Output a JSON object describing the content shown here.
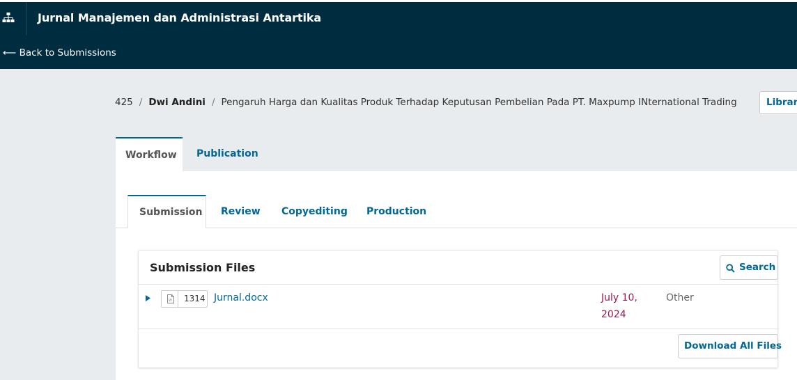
{
  "header": {
    "journal_title": "Jurnal Manajemen dan Administrasi Antartika",
    "back_link": "⟵ Back to Submissions",
    "site_icon": "sitemap-icon"
  },
  "breadcrumb": {
    "id": "425",
    "separator": "/",
    "author": "Dwi Andini",
    "title": "Pengaruh Harga dan Kualitas Produk Terhadap Keputusan Pembelian Pada PT. Maxpump INternational Trading",
    "library_button": "Library"
  },
  "main_tabs": [
    {
      "label": "Workflow",
      "active": true
    },
    {
      "label": "Publication",
      "active": false
    }
  ],
  "sub_tabs": [
    {
      "label": "Submission",
      "active": true
    },
    {
      "label": "Review",
      "active": false
    },
    {
      "label": "Copyediting",
      "active": false
    },
    {
      "label": "Production",
      "active": false
    }
  ],
  "submission_files": {
    "title": "Submission Files",
    "search_label": "Search",
    "files": [
      {
        "id": "1314",
        "name": "Jurnal.docx",
        "date_line1": "July 10,",
        "date_line2": "2024",
        "type": "Other"
      }
    ],
    "download_all_label": "Download All Files"
  },
  "colors": {
    "header_bg": "#002c40",
    "link": "#006798",
    "date": "#9a1750",
    "page_bg": "#e9ecee"
  }
}
